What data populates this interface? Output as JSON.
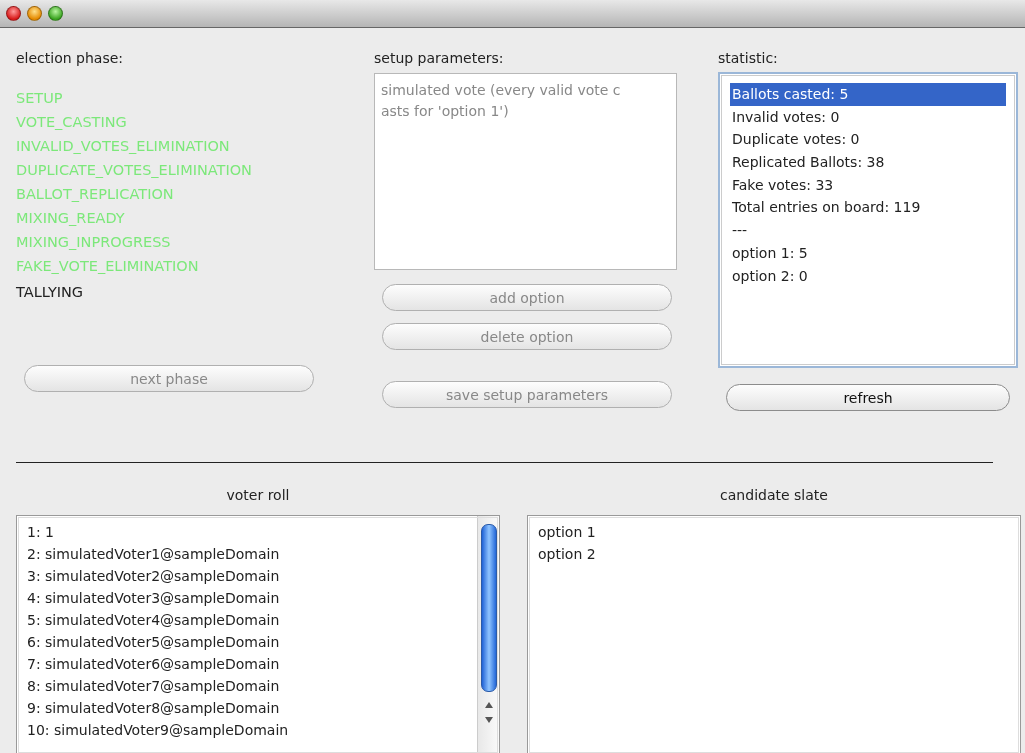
{
  "phase_panel": {
    "heading": "election phase:",
    "phases": [
      {
        "label": "SETUP",
        "done": true
      },
      {
        "label": "VOTE_CASTING",
        "done": true
      },
      {
        "label": "INVALID_VOTES_ELIMINATION",
        "done": true
      },
      {
        "label": "DUPLICATE_VOTES_ELIMINATION",
        "done": true
      },
      {
        "label": "BALLOT_REPLICATION",
        "done": true
      },
      {
        "label": "MIXING_READY",
        "done": true
      },
      {
        "label": "MIXING_INPROGRESS",
        "done": true
      },
      {
        "label": "FAKE_VOTE_ELIMINATION",
        "done": true
      },
      {
        "label": "TALLYING",
        "done": false
      }
    ],
    "button": {
      "label": "next phase",
      "disabled": true
    }
  },
  "setup_panel": {
    "heading": "setup parameters:",
    "text": "simulated vote (every valid vote c\nasts for 'option 1')",
    "buttons": [
      {
        "label": "add option",
        "disabled": true
      },
      {
        "label": "delete option",
        "disabled": true
      }
    ],
    "save_button": {
      "label": "save setup parameters",
      "disabled": true
    }
  },
  "statistic_panel": {
    "heading": "statistic:",
    "items": [
      {
        "text": "Ballots casted: 5",
        "selected": true
      },
      {
        "text": "Invalid votes: 0",
        "selected": false
      },
      {
        "text": "Duplicate votes: 0",
        "selected": false
      },
      {
        "text": "Replicated Ballots: 38",
        "selected": false
      },
      {
        "text": "Fake votes: 33",
        "selected": false
      },
      {
        "text": "Total entries on board: 119",
        "selected": false
      },
      {
        "text": "---",
        "selected": false
      },
      {
        "text": "option 1: 5",
        "selected": false
      },
      {
        "text": "option 2: 0",
        "selected": false
      }
    ],
    "button": {
      "label": "refresh",
      "disabled": false
    }
  },
  "voter_roll": {
    "heading": "voter roll",
    "entries": [
      "1: 1",
      "2: simulatedVoter1@sampleDomain",
      "3: simulatedVoter2@sampleDomain",
      "4: simulatedVoter3@sampleDomain",
      "5: simulatedVoter4@sampleDomain",
      "6: simulatedVoter5@sampleDomain",
      "7: simulatedVoter6@sampleDomain",
      "8: simulatedVoter7@sampleDomain",
      "9: simulatedVoter8@sampleDomain",
      "10: simulatedVoter9@sampleDomain"
    ]
  },
  "candidate_slate": {
    "heading": "candidate slate",
    "entries": [
      "option 1",
      "option 2"
    ]
  }
}
